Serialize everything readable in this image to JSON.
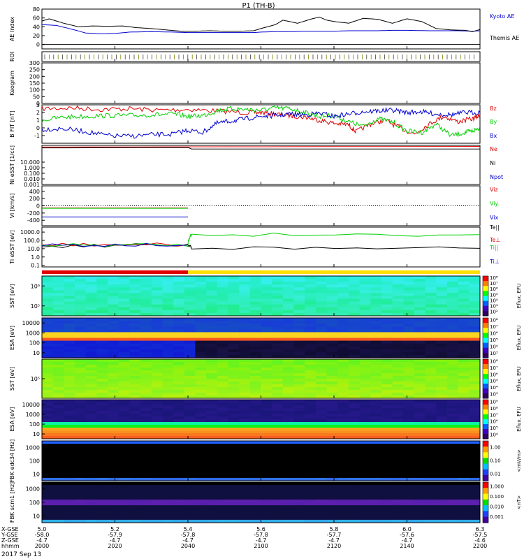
{
  "title": "P1 (TH-B)",
  "date_label": "2017 Sep 13",
  "colors": {
    "red": "#e00000",
    "green": "#00d000",
    "blue": "#0000d0",
    "black": "#000000",
    "mode_bar_slow": "#e00000",
    "mode_bar_fast": "#ffe000"
  },
  "chart_data": [
    {
      "id": "ae",
      "type": "line",
      "ylabel": "AE Index",
      "ylim": [
        -10,
        80
      ],
      "yticks": [
        "80",
        "60",
        "40",
        "20",
        "0"
      ],
      "x_unit": "hhmm",
      "series": [
        {
          "name": "Kyoto AE",
          "color": "#0000d0",
          "x": [
            2000,
            2004,
            2008,
            2012,
            2016,
            2020,
            2024,
            2030,
            2036,
            2040,
            2046,
            2052,
            2058,
            2100,
            2104,
            2108,
            2112,
            2116,
            2120,
            2124,
            2128,
            2132,
            2136,
            2140,
            2146,
            2150,
            2154,
            2158,
            2200
          ],
          "values": [
            45,
            43,
            35,
            26,
            24,
            25,
            28,
            29,
            28,
            27,
            27,
            27,
            27,
            28,
            29,
            29,
            30,
            30,
            30,
            31,
            31,
            31,
            32,
            32,
            31,
            31,
            31,
            30,
            31
          ]
        },
        {
          "name": "Themis AE",
          "color": "#000000",
          "x": [
            2000,
            2002,
            2006,
            2010,
            2014,
            2018,
            2022,
            2026,
            2030,
            2034,
            2038,
            2042,
            2046,
            2050,
            2054,
            2058,
            2100,
            2104,
            2106,
            2110,
            2114,
            2116,
            2118,
            2120,
            2124,
            2128,
            2132,
            2136,
            2140,
            2144,
            2148,
            2152,
            2156,
            2158,
            2200
          ],
          "values": [
            53,
            58,
            48,
            40,
            42,
            41,
            42,
            38,
            36,
            33,
            30,
            30,
            31,
            30,
            30,
            31,
            36,
            45,
            55,
            48,
            58,
            62,
            55,
            52,
            48,
            59,
            57,
            48,
            58,
            52,
            36,
            33,
            32,
            29,
            34
          ]
        }
      ]
    },
    {
      "id": "roi",
      "type": "ticks",
      "ylabel": "ROI"
    },
    {
      "id": "keogram",
      "type": "blank",
      "ylabel": "Keogram",
      "ylim": [
        0,
        300
      ],
      "yticks": [
        "300",
        "250",
        "200",
        "150",
        "100",
        "50",
        "0"
      ]
    },
    {
      "id": "bfield",
      "type": "line",
      "ylabel": "B FIT [nT]",
      "ylim": [
        -2,
        3
      ],
      "yticks": [
        "3",
        "2",
        "1",
        "0",
        "-1"
      ],
      "series": [
        {
          "name": "Bz",
          "color": "#e00000",
          "x": [
            2000,
            2008,
            2016,
            2024,
            2032,
            2040,
            2048,
            2056,
            2100,
            2104,
            2108,
            2112,
            2116,
            2120,
            2124,
            2126,
            2130,
            2134,
            2138,
            2142,
            2146,
            2150,
            2154,
            2158,
            2200
          ],
          "values": [
            2.5,
            2.6,
            2.4,
            2.5,
            2.3,
            2.4,
            2.2,
            2.0,
            2.0,
            1.8,
            1.6,
            1.4,
            1.0,
            0.6,
            0.4,
            -0.5,
            0.5,
            1.0,
            0.0,
            -0.8,
            0.5,
            1.5,
            0.8,
            1.2,
            1.6
          ]
        },
        {
          "name": "By",
          "color": "#00d000",
          "x": [
            2000,
            2006,
            2012,
            2018,
            2024,
            2030,
            2036,
            2040,
            2044,
            2048,
            2052,
            2056,
            2100,
            2104,
            2108,
            2112,
            2116,
            2120,
            2124,
            2128,
            2132,
            2136,
            2140,
            2144,
            2148,
            2152,
            2156,
            2158,
            2200
          ],
          "values": [
            1.0,
            1.4,
            1.5,
            1.6,
            1.6,
            1.7,
            1.8,
            1.5,
            1.6,
            2.2,
            2.5,
            2.4,
            2.3,
            2.6,
            2.5,
            2.0,
            1.5,
            1.6,
            0.8,
            0.2,
            1.2,
            0.8,
            -0.4,
            -0.6,
            0.5,
            -1.0,
            -0.6,
            -0.4,
            0.0
          ]
        },
        {
          "name": "Bx",
          "color": "#0000d0",
          "x": [
            2000,
            2006,
            2012,
            2018,
            2024,
            2030,
            2036,
            2040,
            2044,
            2048,
            2052,
            2056,
            2100,
            2104,
            2108,
            2112,
            2116,
            2120,
            2124,
            2128,
            2132,
            2136,
            2140,
            2144,
            2148,
            2152,
            2156,
            2200
          ],
          "values": [
            -0.2,
            -0.1,
            -0.5,
            -1.0,
            -1.1,
            -0.9,
            -0.8,
            -0.3,
            -0.6,
            0.6,
            0.9,
            1.2,
            1.5,
            1.6,
            1.8,
            1.7,
            1.9,
            1.5,
            1.8,
            2.1,
            2.2,
            2.3,
            2.0,
            2.1,
            1.8,
            1.7,
            2.0,
            2.0
          ]
        }
      ]
    },
    {
      "id": "density",
      "type": "line",
      "log": true,
      "ylabel": "Ni eSST [1/cc]",
      "ylim_log": [
        -3,
        4
      ],
      "yticks": [
        "10.000",
        "1.000",
        "0.100",
        "0.010",
        "0.001"
      ],
      "series": [
        {
          "name": "Ne",
          "color": "#e00000",
          "x": [
            2000,
            2040,
            2200
          ],
          "values": [
            5000,
            5500,
            6500
          ]
        },
        {
          "name": "Ni",
          "color": "#000000",
          "x": [
            2000,
            2040,
            2041,
            2200
          ],
          "values": [
            3500,
            4000,
            2200,
            2200
          ]
        },
        {
          "name": "Npot",
          "color": "#0000d0",
          "x": [
            2000,
            2200
          ],
          "values": [
            0.0001,
            0.0001
          ]
        }
      ]
    },
    {
      "id": "velocity",
      "type": "line",
      "ylabel": "Vi [km/s]",
      "ylim": [
        -550,
        550
      ],
      "yticks": [
        "400",
        "200",
        "0",
        "-200",
        "-400"
      ],
      "series": [
        {
          "name": "Viz",
          "color": "#e00000",
          "x": [
            2000,
            2040
          ],
          "values": [
            -60,
            -60
          ]
        },
        {
          "name": "Viy",
          "color": "#00d000",
          "x": [
            2000,
            2040
          ],
          "values": [
            -70,
            -70
          ]
        },
        {
          "name": "Vix",
          "color": "#0000d0",
          "x": [
            2000,
            2040
          ],
          "values": [
            -310,
            -310
          ]
        }
      ]
    },
    {
      "id": "temperature",
      "type": "line",
      "log": true,
      "ylabel": "Ti eSST [eV]",
      "ylim_log": [
        -1.2,
        3.6
      ],
      "yticks": [
        "1000.0",
        "100.0",
        "10.0",
        "1.0",
        "0.1"
      ],
      "series": [
        {
          "name": "Te||",
          "color": "#000000",
          "x": [
            2000,
            2040,
            2041,
            2200
          ],
          "values": [
            20,
            30,
            12,
            11
          ]
        },
        {
          "name": "Te⊥",
          "color": "#e00000",
          "x": [
            2000,
            2040
          ],
          "values": [
            30,
            30
          ]
        },
        {
          "name": "Ti||",
          "color": "#00d000",
          "x": [
            2000,
            2040,
            2041,
            2200
          ],
          "values": [
            25,
            30,
            500,
            500
          ]
        },
        {
          "name": "Ti⊥",
          "color": "#0000d0",
          "x": [
            2000,
            2040
          ],
          "values": [
            28,
            28
          ]
        }
      ]
    },
    {
      "id": "ion-sst-spec",
      "type": "heatmap",
      "ylabel": "SST [eV]",
      "yticks": [
        "10⁶",
        "10⁵"
      ],
      "colorbar": {
        "title": "Eflux, EFU",
        "ticks": [
          "10⁸",
          "10⁷",
          "10⁶",
          "10⁵",
          "10⁴",
          "10³",
          "10²"
        ]
      }
    },
    {
      "id": "ion-esa-spec",
      "type": "heatmap",
      "ylabel": "ESA [eV]",
      "yticks": [
        "10000",
        "1000",
        "100",
        "10"
      ],
      "colorbar": {
        "title": "Eflux, EFU",
        "ticks": [
          "10⁸",
          "10⁷",
          "10⁶",
          "10⁵",
          "10⁴",
          "10³"
        ]
      }
    },
    {
      "id": "elec-sst-spec",
      "type": "heatmap",
      "ylabel": "SST [eV]",
      "yticks": [
        "10⁵"
      ],
      "colorbar": {
        "title": "Eflux, EFU",
        "ticks": [
          "10⁸",
          "10⁷",
          "10⁶",
          "10⁵",
          "10⁴",
          "10³"
        ]
      }
    },
    {
      "id": "elec-esa-spec",
      "type": "heatmap",
      "ylabel": "ESA [eV]",
      "yticks": [
        "10000",
        "1000",
        "100",
        "10"
      ],
      "colorbar": {
        "title": "Eflux, EFU",
        "ticks": [
          "10⁹",
          "10⁸",
          "10⁷",
          "10⁶",
          "10⁵",
          "10⁴"
        ]
      }
    },
    {
      "id": "fbk-edc",
      "type": "heatmap",
      "ylabel": "FBK edc34 [Hz]",
      "yticks": [
        "1000",
        "100",
        "10"
      ],
      "colorbar": {
        "title": "<mV/m>",
        "ticks": [
          "1.00",
          "0.10",
          "0.01"
        ]
      }
    },
    {
      "id": "fbk-scm",
      "type": "heatmap",
      "ylabel": "FBK scm1 [Hz]",
      "yticks": [
        "1000",
        "100",
        "10"
      ],
      "colorbar": {
        "title": "<nT>",
        "ticks": [
          "1.000",
          "0.100",
          "0.010",
          "0.001"
        ]
      }
    }
  ],
  "x_axis": {
    "row_labels": [
      "X-GSE",
      "Y-GSE",
      "Z-GSE",
      "hhmm"
    ],
    "columns": [
      {
        "x": "5.0",
        "y": "-58.0",
        "z": "-4.7",
        "t": "2000"
      },
      {
        "x": "5.2",
        "y": "-57.9",
        "z": "-4.7",
        "t": "2020"
      },
      {
        "x": "5.4",
        "y": "-57.8",
        "z": "-4.7",
        "t": "2040"
      },
      {
        "x": "5.6",
        "y": "-57.8",
        "z": "-4.7",
        "t": "2100"
      },
      {
        "x": "5.8",
        "y": "-57.7",
        "z": "-4.7",
        "t": "2120"
      },
      {
        "x": "6.0",
        "y": "-57.6",
        "z": "-4.7",
        "t": "2140"
      },
      {
        "x": "6.3",
        "y": "-57.5",
        "z": "-4.6",
        "t": "2200"
      }
    ]
  }
}
